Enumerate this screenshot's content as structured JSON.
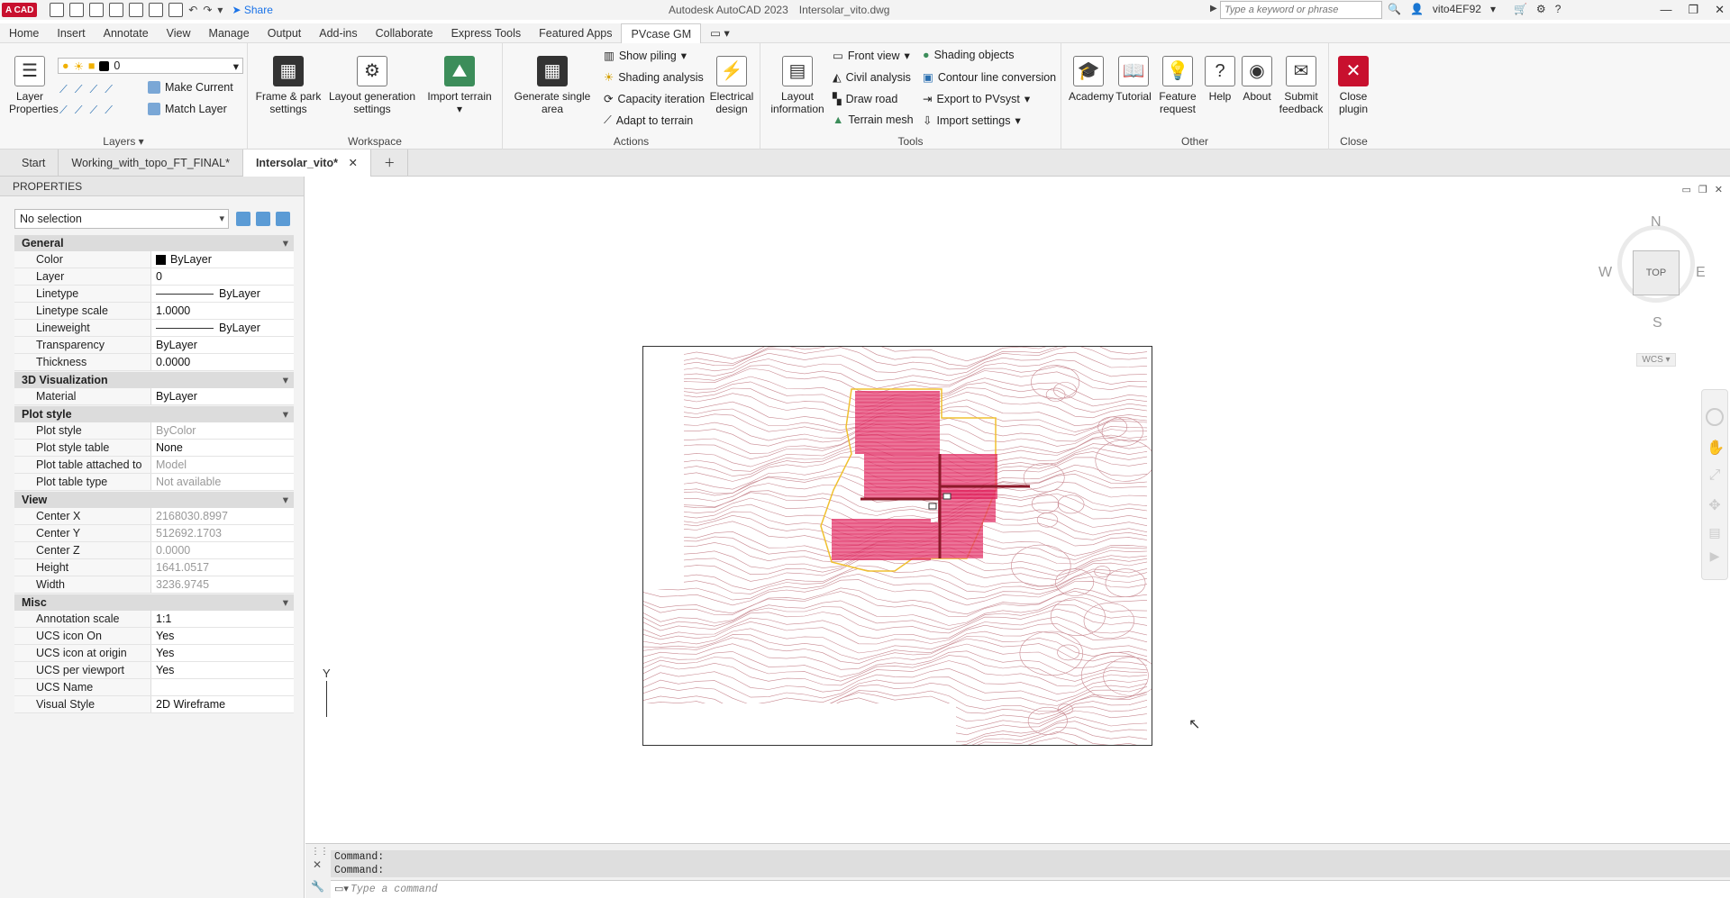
{
  "app": {
    "logo": "A CAD",
    "title": "Autodesk AutoCAD 2023",
    "filename": "Intersolar_vito.dwg",
    "share_label": "Share",
    "search_placeholder": "Type a keyword or phrase",
    "user": "vito4EF92"
  },
  "menu": [
    "Home",
    "Insert",
    "Annotate",
    "View",
    "Manage",
    "Output",
    "Add-ins",
    "Collaborate",
    "Express Tools",
    "Featured Apps",
    "PVcase GM"
  ],
  "ribbon": {
    "layers": {
      "title": "Layers",
      "layer_props": "Layer Properties",
      "layer_name": "0",
      "make_current": "Make Current",
      "match_layer": "Match Layer"
    },
    "workspace": {
      "title": "Workspace",
      "frame_park": "Frame & park settings",
      "layout_gen": "Layout generation settings",
      "import_terrain": "Import terrain"
    },
    "actions": {
      "title": "Actions",
      "generate_single": "Generate single area",
      "show_piling": "Show piling",
      "shading_analysis": "Shading analysis",
      "capacity_iteration": "Capacity iteration",
      "adapt_terrain": "Adapt to terrain",
      "electrical_design": "Electrical design"
    },
    "tools": {
      "title": "Tools",
      "layout_info": "Layout information",
      "front_view": "Front view",
      "civil_analysis": "Civil analysis",
      "draw_road": "Draw road",
      "terrain_mesh": "Terrain mesh",
      "shading_objects": "Shading objects",
      "contour_conversion": "Contour line conversion",
      "export_pvsyst": "Export to PVsyst",
      "import_settings": "Import settings"
    },
    "other": {
      "title": "Other",
      "academy": "Academy",
      "tutorial": "Tutorial",
      "feature_request": "Feature request",
      "help": "Help",
      "about": "About",
      "submit_feedback": "Submit feedback"
    },
    "close": {
      "title": "Close",
      "close_plugin": "Close plugin"
    }
  },
  "tabs": [
    "Start",
    "Working_with_topo_FT_FINAL*",
    "Intersolar_vito*"
  ],
  "properties": {
    "header": "PROPERTIES",
    "selection": "No selection",
    "general": {
      "title": "General",
      "color": [
        "Color",
        "ByLayer"
      ],
      "layer": [
        "Layer",
        "0"
      ],
      "linetype": [
        "Linetype",
        "ByLayer"
      ],
      "linetype_scale": [
        "Linetype scale",
        "1.0000"
      ],
      "lineweight": [
        "Lineweight",
        "ByLayer"
      ],
      "transparency": [
        "Transparency",
        "ByLayer"
      ],
      "thickness": [
        "Thickness",
        "0.0000"
      ]
    },
    "viz": {
      "title": "3D Visualization",
      "material": [
        "Material",
        "ByLayer"
      ]
    },
    "plot": {
      "title": "Plot style",
      "style": [
        "Plot style",
        "ByColor"
      ],
      "table": [
        "Plot style table",
        "None"
      ],
      "attached": [
        "Plot table attached to",
        "Model"
      ],
      "type": [
        "Plot table type",
        "Not available"
      ]
    },
    "view": {
      "title": "View",
      "cx": [
        "Center X",
        "2168030.8997"
      ],
      "cy": [
        "Center Y",
        "512692.1703"
      ],
      "cz": [
        "Center Z",
        "0.0000"
      ],
      "height": [
        "Height",
        "1641.0517"
      ],
      "width": [
        "Width",
        "3236.9745"
      ]
    },
    "misc": {
      "title": "Misc",
      "anno": [
        "Annotation scale",
        "1:1"
      ],
      "ucs_on": [
        "UCS icon On",
        "Yes"
      ],
      "ucs_origin": [
        "UCS icon at origin",
        "Yes"
      ],
      "ucs_vp": [
        "UCS per viewport",
        "Yes"
      ],
      "ucs_name": [
        "UCS Name",
        ""
      ],
      "visual": [
        "Visual Style",
        "2D Wireframe"
      ]
    }
  },
  "viewcube": {
    "n": "N",
    "s": "S",
    "e": "E",
    "w": "W",
    "top": "TOP",
    "wcs": "WCS"
  },
  "ucs_label": "Y",
  "command": {
    "line1": "Command:",
    "line2": "Command:",
    "placeholder": "Type a command"
  },
  "colors": {
    "contour": "#c98a92",
    "array": "#e0245e",
    "boundary": "#f0c030",
    "road": "#8b1a2a"
  }
}
